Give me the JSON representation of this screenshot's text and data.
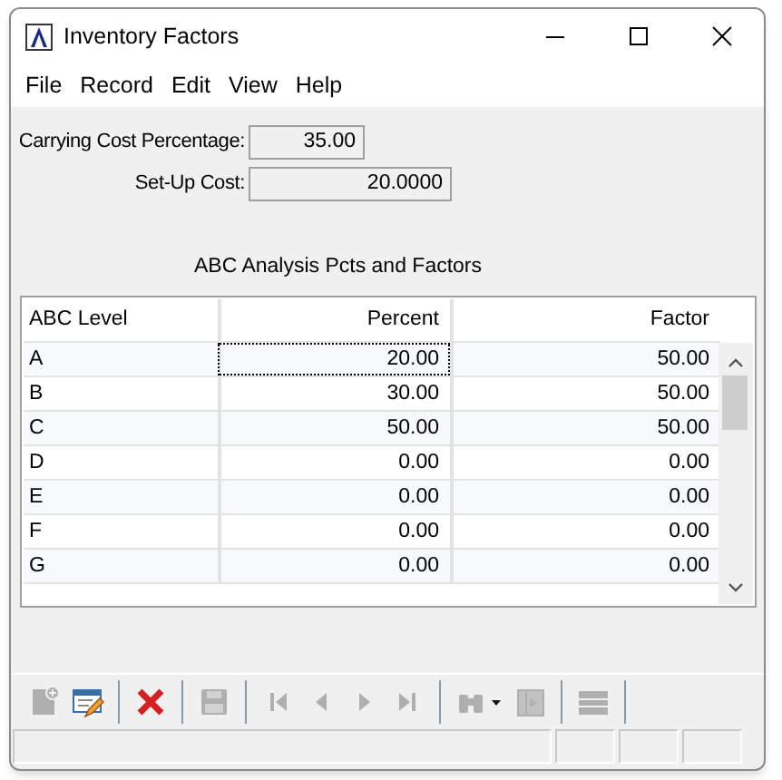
{
  "window": {
    "title": "Inventory Factors"
  },
  "menu": [
    "File",
    "Record",
    "Edit",
    "View",
    "Help"
  ],
  "fields": [
    {
      "label": "Carrying Cost Percentage:",
      "value": "35.00"
    },
    {
      "label": "Set-Up Cost:",
      "value": "20.0000"
    }
  ],
  "table": {
    "title": "ABC Analysis Pcts and Factors",
    "columns": [
      "ABC Level",
      "Percent",
      "Factor"
    ],
    "rows": [
      {
        "level": "A",
        "percent": "20.00",
        "factor": "50.00",
        "focused": true
      },
      {
        "level": "B",
        "percent": "30.00",
        "factor": "50.00",
        "focused": false
      },
      {
        "level": "C",
        "percent": "50.00",
        "factor": "50.00",
        "focused": false
      },
      {
        "level": "D",
        "percent": "0.00",
        "factor": "0.00",
        "focused": false
      },
      {
        "level": "E",
        "percent": "0.00",
        "factor": "0.00",
        "focused": false
      },
      {
        "level": "F",
        "percent": "0.00",
        "factor": "0.00",
        "focused": false
      },
      {
        "level": "G",
        "percent": "0.00",
        "factor": "0.00",
        "focused": false
      }
    ]
  },
  "toolbar": [
    {
      "kind": "new",
      "disabled": true
    },
    {
      "kind": "edit",
      "disabled": false
    },
    {
      "kind": "sep"
    },
    {
      "kind": "delete",
      "disabled": false
    },
    {
      "kind": "sep"
    },
    {
      "kind": "save",
      "disabled": true
    },
    {
      "kind": "sep"
    },
    {
      "kind": "first",
      "disabled": true
    },
    {
      "kind": "prev",
      "disabled": true
    },
    {
      "kind": "next",
      "disabled": true
    },
    {
      "kind": "last",
      "disabled": true
    },
    {
      "kind": "sep"
    },
    {
      "kind": "find",
      "disabled": true
    },
    {
      "kind": "exit",
      "disabled": true
    },
    {
      "kind": "sep"
    },
    {
      "kind": "list",
      "disabled": true
    },
    {
      "kind": "sep"
    }
  ]
}
